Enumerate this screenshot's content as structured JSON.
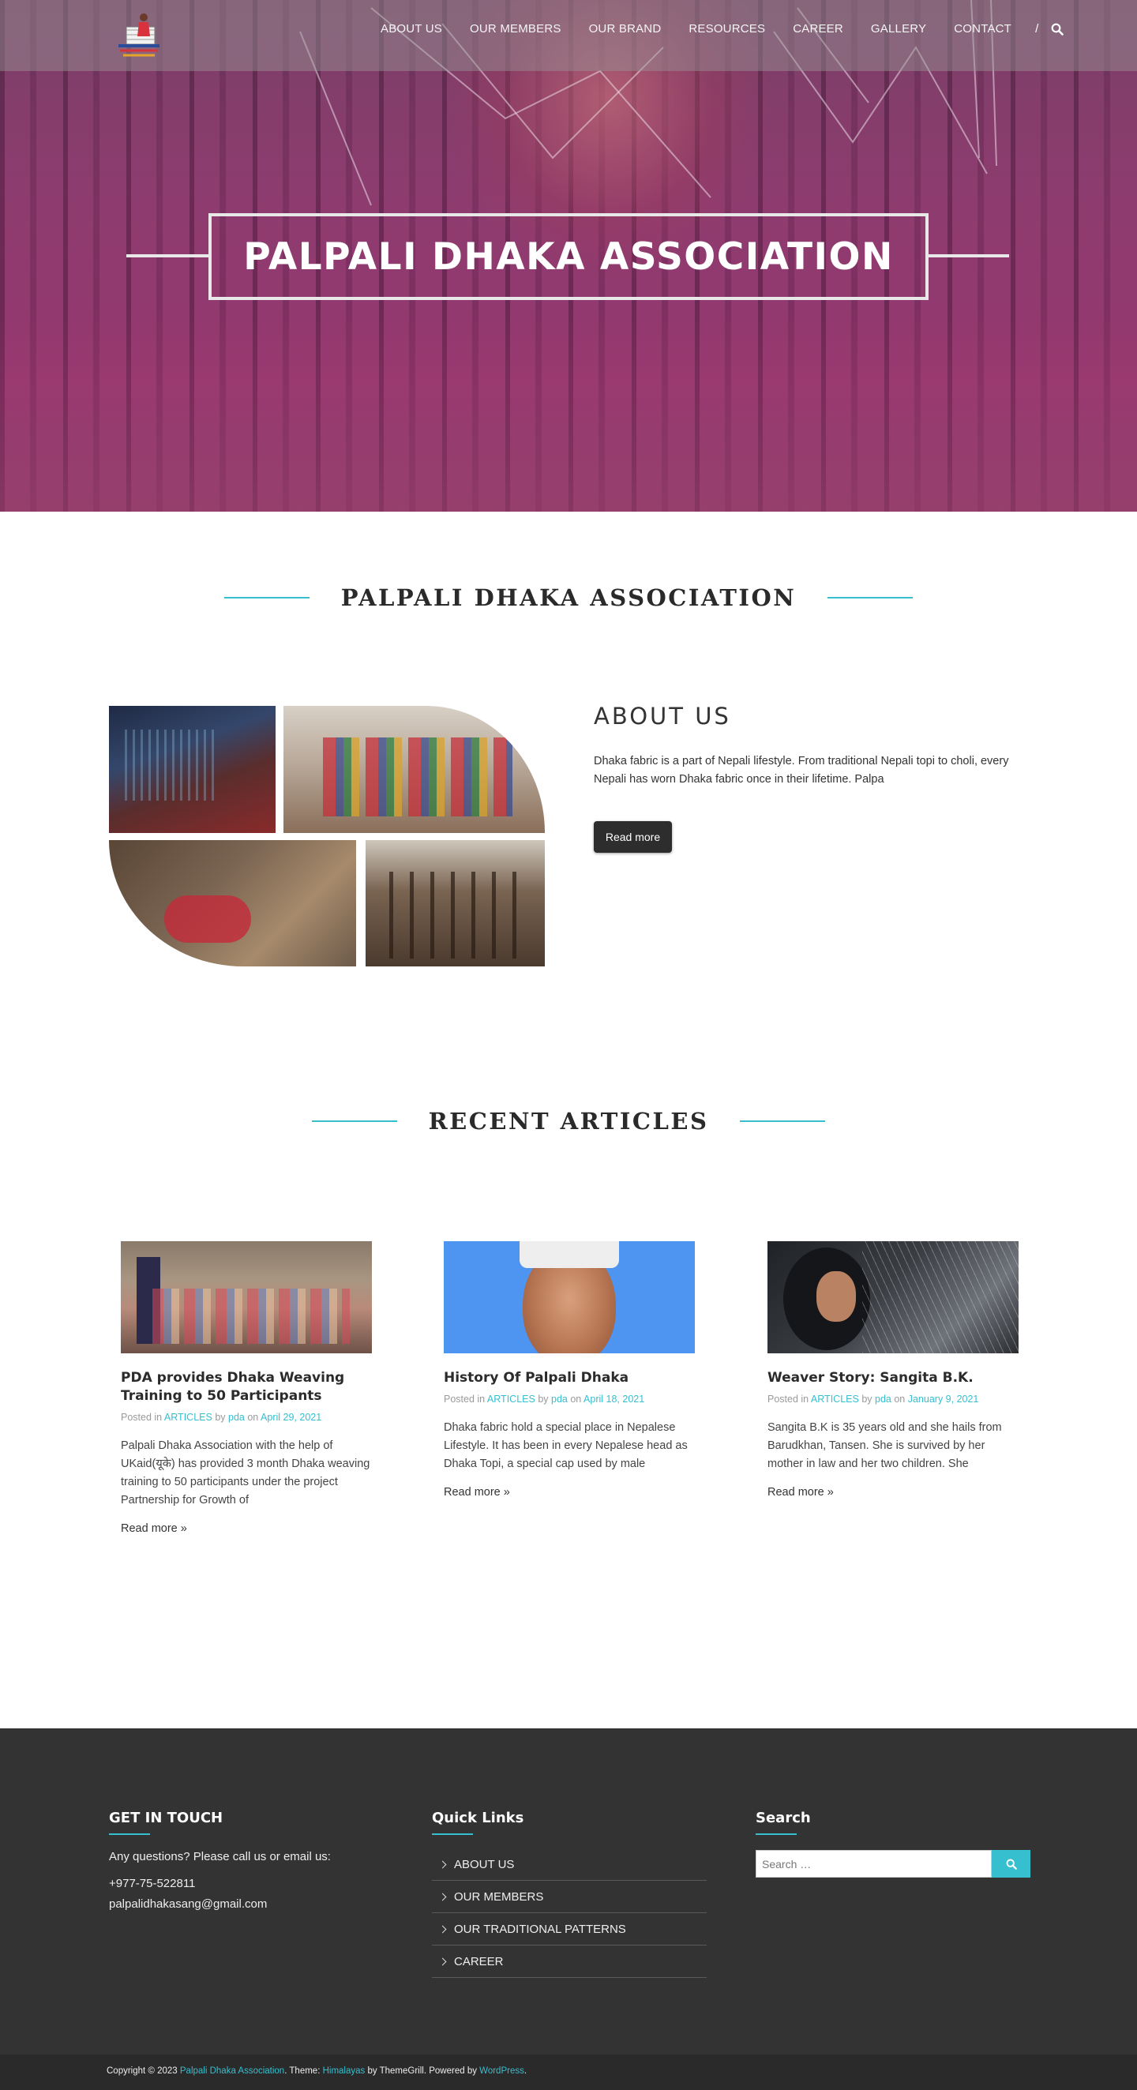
{
  "nav": {
    "items": [
      "ABOUT US",
      "OUR MEMBERS",
      "OUR BRAND",
      "RESOURCES",
      "CAREER",
      "GALLERY",
      "CONTACT"
    ],
    "separator": "/",
    "search_icon": "search-icon"
  },
  "hero": {
    "title": "PALPALI DHAKA ASSOCIATION"
  },
  "section_title": "PALPALI DHAKA ASSOCIATION",
  "about": {
    "heading": "ABOUT US",
    "text": "Dhaka fabric is a part of Nepali lifestyle. From traditional Nepali topi to choli, every Nepali has worn Dhaka fabric once in their lifetime. Palpa",
    "button": "Read more"
  },
  "articles": {
    "title": "RECENT ARTICLES",
    "posted_in": "Posted in",
    "by": "by",
    "on": "on",
    "read_more": "Read more",
    "items": [
      {
        "title": "PDA provides Dhaka Weaving Training to 50 Participants",
        "category": "ARTICLES",
        "author": "pda",
        "date": "April 29, 2021",
        "excerpt": "Palpali Dhaka Association with the help of UKaid(यूके) has provided 3 month Dhaka weaving training to 50 participants under the project Partnership for Growth of"
      },
      {
        "title": "History Of Palpali Dhaka",
        "category": "ARTICLES",
        "author": "pda",
        "date": "April 18, 2021",
        "excerpt": "Dhaka fabric hold a special place in Nepalese Lifestyle. It has been in every Nepalese head as Dhaka Topi, a special cap used by male"
      },
      {
        "title": "Weaver Story: Sangita B.K.",
        "category": "ARTICLES",
        "author": "pda",
        "date": "January 9, 2021",
        "excerpt": "Sangita B.K is 35 years old and she hails from Barudkhan, Tansen. She is survived by her mother in law and her two children. She"
      }
    ]
  },
  "footer": {
    "contact": {
      "title": "GET IN TOUCH",
      "text": "Any questions? Please call us or email us:",
      "phone": "+977-75-522811",
      "email": "palpalidhakasang@gmail.com"
    },
    "quick_links": {
      "title": "Quick Links",
      "items": [
        "ABOUT US",
        "OUR MEMBERS",
        "OUR TRADITIONAL PATTERNS",
        "CAREER"
      ]
    },
    "search": {
      "title": "Search",
      "placeholder": "Search …"
    },
    "copyright": {
      "prefix": "Copyright © 2023",
      "site": "Palpali Dhaka Association",
      "theme_label": ". Theme:",
      "theme": "Himalayas",
      "by_label": "by ThemeGrill. Powered by",
      "wp": "WordPress",
      "end": "."
    }
  },
  "colors": {
    "accent": "#35bfcf",
    "footer_bg": "#333333",
    "button_dark": "#2d2d2d"
  }
}
